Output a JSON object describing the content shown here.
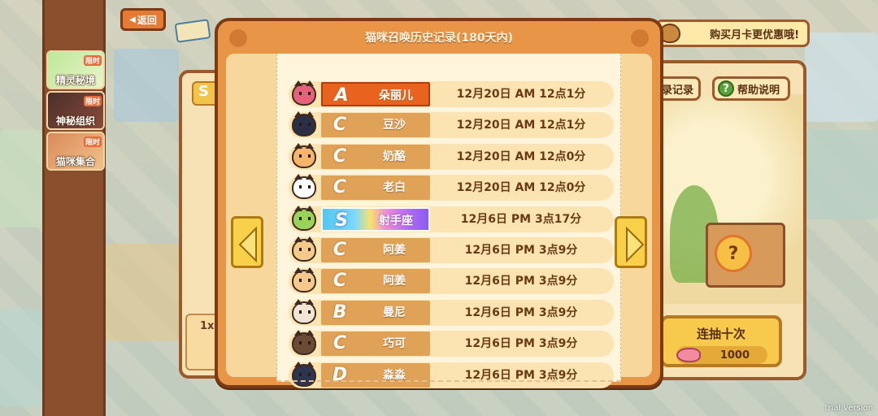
{
  "top": {
    "back_label": "返回",
    "monthly_card_label": "购买月卡更优惠哦!"
  },
  "sidebar": {
    "items": [
      {
        "label": "精灵秘境",
        "badge": "限时"
      },
      {
        "label": "神秘组织",
        "badge": "限时"
      },
      {
        "label": "猫咪集合",
        "badge": "限时"
      }
    ]
  },
  "background_panel": {
    "record_label": "录记录",
    "help_label": "帮助说明",
    "help_icon": "?",
    "draw_ten_label": "连抽十次",
    "draw_ten_cost": "1000",
    "single_label": "1x",
    "s_tag": "S"
  },
  "modal": {
    "title": "猫咪召唤历史记录(180天内)",
    "rows": [
      {
        "rank": "A",
        "name": "朵丽儿",
        "time": "12月20日 AM 12点1分",
        "avatar_color": "#e6627a"
      },
      {
        "rank": "C",
        "name": "豆沙",
        "time": "12月20日 AM 12点1分",
        "avatar_color": "#2a2f45"
      },
      {
        "rank": "C",
        "name": "奶酪",
        "time": "12月20日 AM 12点0分",
        "avatar_color": "#f5b56b"
      },
      {
        "rank": "C",
        "name": "老白",
        "time": "12月20日 AM 12点0分",
        "avatar_color": "#ffffff"
      },
      {
        "rank": "S",
        "name": "射手座",
        "time": "12月6日 PM 3点17分",
        "avatar_color": "#9ad35a"
      },
      {
        "rank": "C",
        "name": "阿姜",
        "time": "12月6日 PM 3点9分",
        "avatar_color": "#f5c98a"
      },
      {
        "rank": "C",
        "name": "阿姜",
        "time": "12月6日 PM 3点9分",
        "avatar_color": "#f5c98a"
      },
      {
        "rank": "B",
        "name": "曼尼",
        "time": "12月6日 PM 3点9分",
        "avatar_color": "#f1e6d6"
      },
      {
        "rank": "C",
        "name": "巧可",
        "time": "12月6日 PM 3点9分",
        "avatar_color": "#6b4a36"
      },
      {
        "rank": "D",
        "name": "淼淼",
        "time": "12月6日 PM 3点9分",
        "avatar_color": "#2c3650"
      }
    ]
  },
  "footer": {
    "trial_label": "trial version"
  },
  "colors": {
    "modal_border": "#7a3a14",
    "modal_fill": "#e99548",
    "rank_A": "#e8641e",
    "arrow": "#f9d04a"
  },
  "icons": {
    "back": "triangle-left",
    "prev": "arrow-left-icon",
    "next": "arrow-right-icon"
  }
}
